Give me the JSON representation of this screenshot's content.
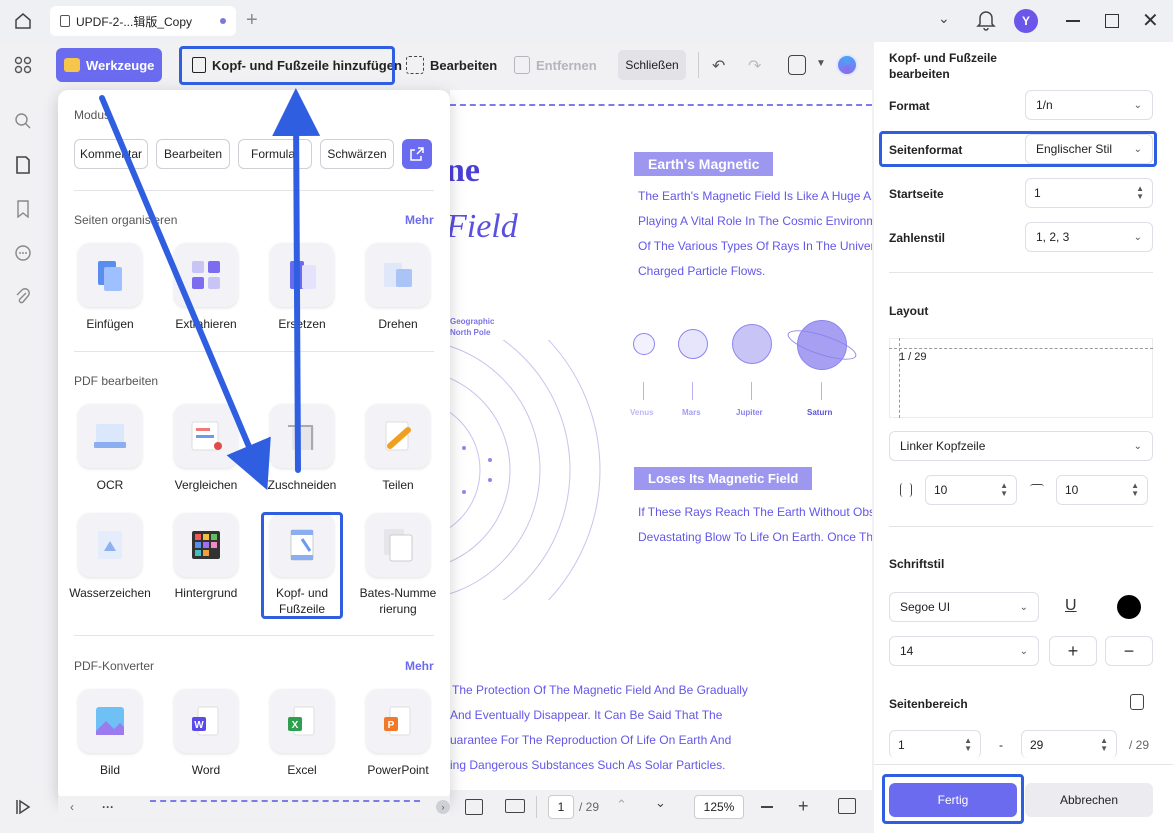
{
  "tab": {
    "title": "UPDF-2-...辑版_Copy"
  },
  "user": {
    "avatar_letter": "Y"
  },
  "toolbar": {
    "tools_label": "Werkzeuge",
    "header_footer_label": "Kopf- und Fußzeile hinzufügen",
    "edit_label": "Bearbeiten",
    "remove_label": "Entfernen",
    "close_label": "Schließen"
  },
  "tools_panel": {
    "modes_title": "Modus",
    "modes": [
      "Kommentar",
      "Bearbeiten",
      "Formular",
      "Schwärzen"
    ],
    "organize_title": "Seiten organisieren",
    "organize_more": "Mehr",
    "organize_items": [
      "Einfügen",
      "Extrahieren",
      "Ersetzen",
      "Drehen"
    ],
    "edit_title": "PDF bearbeiten",
    "edit_items": [
      "OCR",
      "Vergleichen",
      "Zuschneiden",
      "Teilen"
    ],
    "edit_items2": [
      "Wasserzeichen",
      "Hintergrund",
      "Kopf- und Fußzeile",
      "Bates-Nummerierung"
    ],
    "convert_title": "PDF-Konverter",
    "convert_more": "Mehr",
    "convert_items": [
      "Bild",
      "Word",
      "Excel",
      "PowerPoint"
    ]
  },
  "doc": {
    "title_fragment1": "ne",
    "title_fragment2": "Field",
    "heading1": "Earth's Magnetic",
    "para1": [
      "The Earth's Magnetic Field Is Like A Huge Ar",
      "Playing A Vital Role In The Cosmic Environm",
      "Of The Various Types Of Rays In The Univers",
      "Charged Particle Flows."
    ],
    "geo_label": [
      "Geographic",
      "North Pole"
    ],
    "planets": [
      "Venus",
      "Mars",
      "Jupiter",
      "Saturn"
    ],
    "heading2": "Loses Its Magnetic Field",
    "para2": [
      "If These Rays Reach The Earth Without Obst",
      "Devastating Blow To Life On Earth. Once The"
    ],
    "para3": [
      "The Protection Of The Magnetic Field And Be Gradually",
      "And Eventually Disappear. It Can Be Said That The",
      "uarantee For The Reproduction Of Life On Earth And",
      "ing Dangerous Substances Such As Solar Particles."
    ]
  },
  "bottom_bar": {
    "page": "1",
    "total": "/ 29",
    "zoom": "125%"
  },
  "right_panel": {
    "title": "Kopf- und Fußzeile bearbeiten",
    "format_label": "Format",
    "format_value": "1/n",
    "page_format_label": "Seitenformat",
    "page_format_value": "Englischer Stil",
    "start_label": "Startseite",
    "start_value": "1",
    "number_style_label": "Zahlenstil",
    "number_style_value": "1, 2, 3",
    "layout_label": "Layout",
    "layout_preview": "1 / 29",
    "position_value": "Linker Kopfzeile",
    "margin_left": "10",
    "margin_top": "10",
    "font_label": "Schriftstil",
    "font_value": "Segoe UI",
    "size_value": "14",
    "range_label": "Seitenbereich",
    "range_from": "1",
    "range_dash": "-",
    "range_to": "29",
    "range_total": "/ 29",
    "done_label": "Fertig",
    "cancel_label": "Abbrechen"
  },
  "colors": {
    "accent": "#6b6bf0",
    "highlight": "#2f5fe0",
    "doc_text": "#6357e8"
  }
}
